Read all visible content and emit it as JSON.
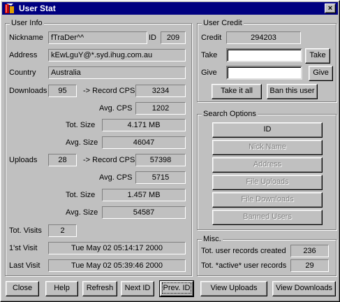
{
  "window": {
    "title": "User Stat",
    "close_glyph": "×"
  },
  "user_info": {
    "title": "User Info",
    "nickname_label": "Nickname",
    "nickname": "fTraDer^^",
    "id_label": "ID",
    "id": "209",
    "address_label": "Address",
    "address": "kEwLguY@*.syd.ihug.com.au",
    "country_label": "Country",
    "country": "Australia",
    "downloads_label": "Downloads",
    "downloads": "95",
    "downloads_record_label": "-> Record CPS",
    "downloads_record_cps": "3234",
    "downloads_avg_cps_label": "Avg. CPS",
    "downloads_avg_cps": "1202",
    "downloads_tot_size_label": "Tot. Size",
    "downloads_tot_size": "4.171 MB",
    "downloads_avg_size_label": "Avg. Size",
    "downloads_avg_size": "46047",
    "uploads_label": "Uploads",
    "uploads": "28",
    "uploads_record_label": "-> Record CPS",
    "uploads_record_cps": "57398",
    "uploads_avg_cps_label": "Avg. CPS",
    "uploads_avg_cps": "5715",
    "uploads_tot_size_label": "Tot. Size",
    "uploads_tot_size": "1.457 MB",
    "uploads_avg_size_label": "Avg. Size",
    "uploads_avg_size": "54587",
    "tot_visits_label": "Tot. Visits",
    "tot_visits": "2",
    "first_visit_label": "1'st Visit",
    "first_visit": "Tue May 02 05:14:17 2000",
    "last_visit_label": "Last Visit",
    "last_visit": "Tue May 02 05:39:46 2000"
  },
  "user_credit": {
    "title": "User Credit",
    "credit_label": "Credit",
    "credit": "294203",
    "take_label": "Take",
    "take_value": "",
    "take_button": "Take",
    "give_label": "Give",
    "give_value": "",
    "give_button": "Give",
    "take_it_all_button": "Take it all",
    "ban_button": "Ban this user"
  },
  "search_options": {
    "title": "Search Options",
    "buttons": [
      "ID",
      "Nick Name",
      "Address",
      "File Uploads",
      "File Downloads",
      "Banned Users"
    ]
  },
  "misc": {
    "title": "Misc.",
    "total_records_label": "Tot. user records created",
    "total_records": "236",
    "active_records_label": "Tot. *active* user records",
    "active_records": "29"
  },
  "footer": {
    "close": "Close",
    "help": "Help",
    "refresh": "Refresh",
    "next_id": "Next ID",
    "prev_id": "Prev. ID",
    "view_uploads": "View Uploads",
    "view_downloads": "View Downloads"
  },
  "colors": {
    "titlebar": "#000080",
    "face": "#c0c0c0",
    "disabled_text": "#808080"
  }
}
